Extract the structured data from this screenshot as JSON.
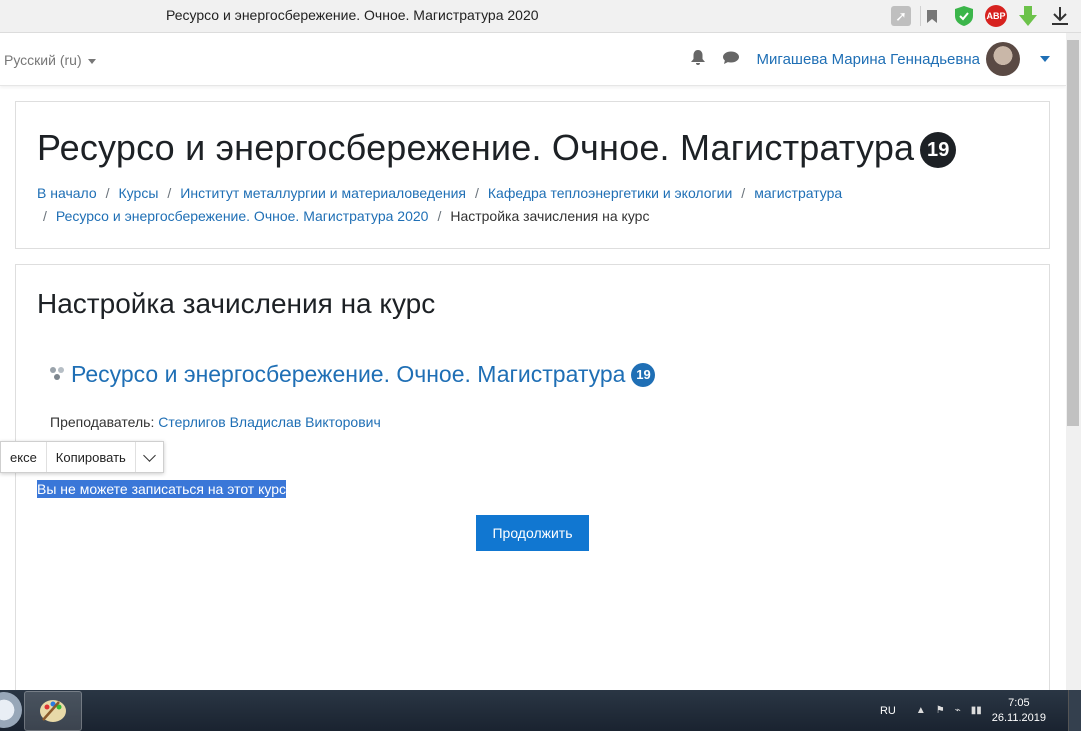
{
  "browser": {
    "tab_title": "Ресурсо и энергосбережение. Очное. Магистратура 2020",
    "extensions": [
      "rocket-icon",
      "bookmark-icon",
      "shield-icon",
      "abp-icon",
      "arrow-down-icon",
      "download-icon"
    ],
    "abp_label": "ABP"
  },
  "navbar": {
    "language": "Русский (ru)",
    "user_name": "Мигашева Марина Геннадьевна"
  },
  "header": {
    "title": "Ресурсо и энергосбережение. Очное. Магистратура",
    "badge": "19",
    "breadcrumb": [
      "В начало",
      "Курсы",
      "Институт металлургии и материаловедения",
      "Кафедра теплоэнергетики и экологии",
      "магистратура",
      "Ресурсо и энергосбережение. Очное. Магистратура 2020",
      "Настройка зачисления на курс"
    ]
  },
  "main": {
    "section_title": "Настройка зачисления на курс",
    "course_name": "Ресурсо и энергосбережение. Очное. Магистратура",
    "course_badge": "19",
    "teacher_label": "Преподаватель:",
    "teacher_name": "Стерлигов Владислав Викторович",
    "notice": "Вы не можете записаться на этот курс",
    "continue_label": "Продолжить"
  },
  "selection_popup": {
    "item1": "ексе",
    "item2": "Копировать"
  },
  "taskbar": {
    "lang": "RU",
    "time": "7:05",
    "date": "26.11.2019"
  },
  "colors": {
    "link": "#1f6fb5",
    "primary_button": "#1177d1",
    "selection": "#3a77d8"
  }
}
